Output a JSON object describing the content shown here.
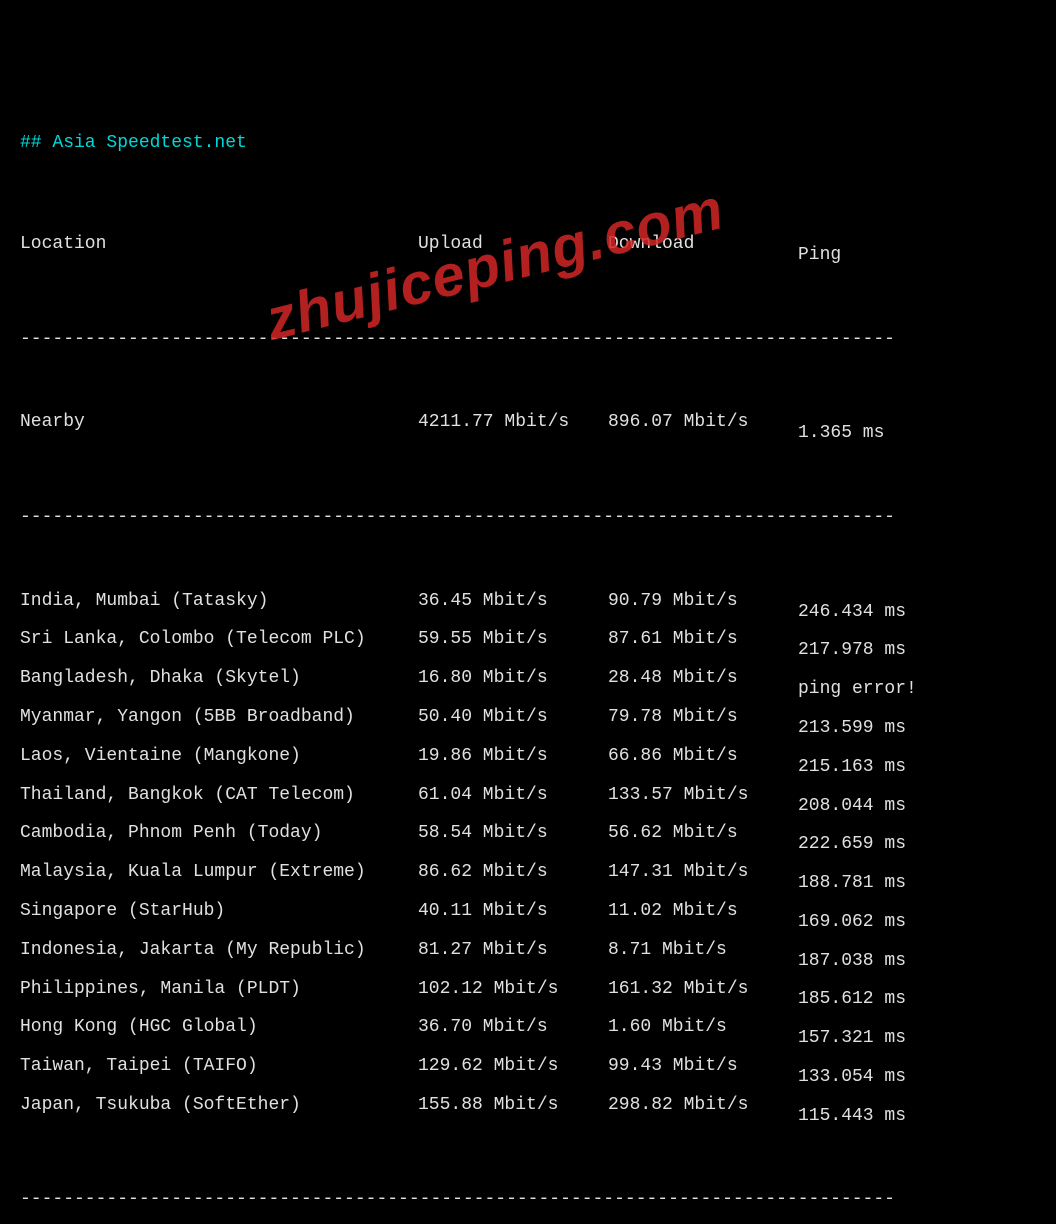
{
  "title": "## Asia Speedtest.net",
  "headers": {
    "location": "Location",
    "upload": "Upload",
    "download": "Download",
    "ping": "Ping"
  },
  "divider": "---------------------------------------------------------------------------------",
  "nearby": {
    "location": "Nearby",
    "upload": "4211.77 Mbit/s",
    "download": "896.07 Mbit/s",
    "ping": "1.365 ms"
  },
  "rows": [
    {
      "location": "India, Mumbai (Tatasky)",
      "upload": "36.45 Mbit/s",
      "download": "90.79 Mbit/s",
      "ping": "246.434 ms"
    },
    {
      "location": "Sri Lanka, Colombo (Telecom PLC)",
      "upload": "59.55 Mbit/s",
      "download": "87.61 Mbit/s",
      "ping": "217.978 ms"
    },
    {
      "location": "Bangladesh, Dhaka (Skytel)",
      "upload": "16.80 Mbit/s",
      "download": "28.48 Mbit/s",
      "ping": "ping error!"
    },
    {
      "location": "Myanmar, Yangon (5BB Broadband)",
      "upload": "50.40 Mbit/s",
      "download": "79.78 Mbit/s",
      "ping": "213.599 ms"
    },
    {
      "location": "Laos, Vientaine (Mangkone)",
      "upload": "19.86 Mbit/s",
      "download": "66.86 Mbit/s",
      "ping": "215.163 ms"
    },
    {
      "location": "Thailand, Bangkok (CAT Telecom)",
      "upload": "61.04 Mbit/s",
      "download": "133.57 Mbit/s",
      "ping": "208.044 ms"
    },
    {
      "location": "Cambodia, Phnom Penh (Today)",
      "upload": "58.54 Mbit/s",
      "download": "56.62 Mbit/s",
      "ping": "222.659 ms"
    },
    {
      "location": "Malaysia, Kuala Lumpur (Extreme)",
      "upload": "86.62 Mbit/s",
      "download": "147.31 Mbit/s",
      "ping": "188.781 ms"
    },
    {
      "location": "Singapore (StarHub)",
      "upload": "40.11 Mbit/s",
      "download": "11.02 Mbit/s",
      "ping": "169.062 ms"
    },
    {
      "location": "Indonesia, Jakarta (My Republic)",
      "upload": "81.27 Mbit/s",
      "download": "8.71 Mbit/s",
      "ping": "187.038 ms"
    },
    {
      "location": "Philippines, Manila (PLDT)",
      "upload": "102.12 Mbit/s",
      "download": "161.32 Mbit/s",
      "ping": "185.612 ms"
    },
    {
      "location": "Hong Kong (HGC Global)",
      "upload": "36.70 Mbit/s",
      "download": "1.60 Mbit/s",
      "ping": "157.321 ms"
    },
    {
      "location": "Taiwan, Taipei (TAIFO)",
      "upload": "129.62 Mbit/s",
      "download": "99.43 Mbit/s",
      "ping": "133.054 ms"
    },
    {
      "location": "Japan, Tsukuba (SoftEther)",
      "upload": "155.88 Mbit/s",
      "download": "298.82 Mbit/s",
      "ping": "115.443 ms"
    }
  ],
  "watermark": "zhujiceping.com"
}
